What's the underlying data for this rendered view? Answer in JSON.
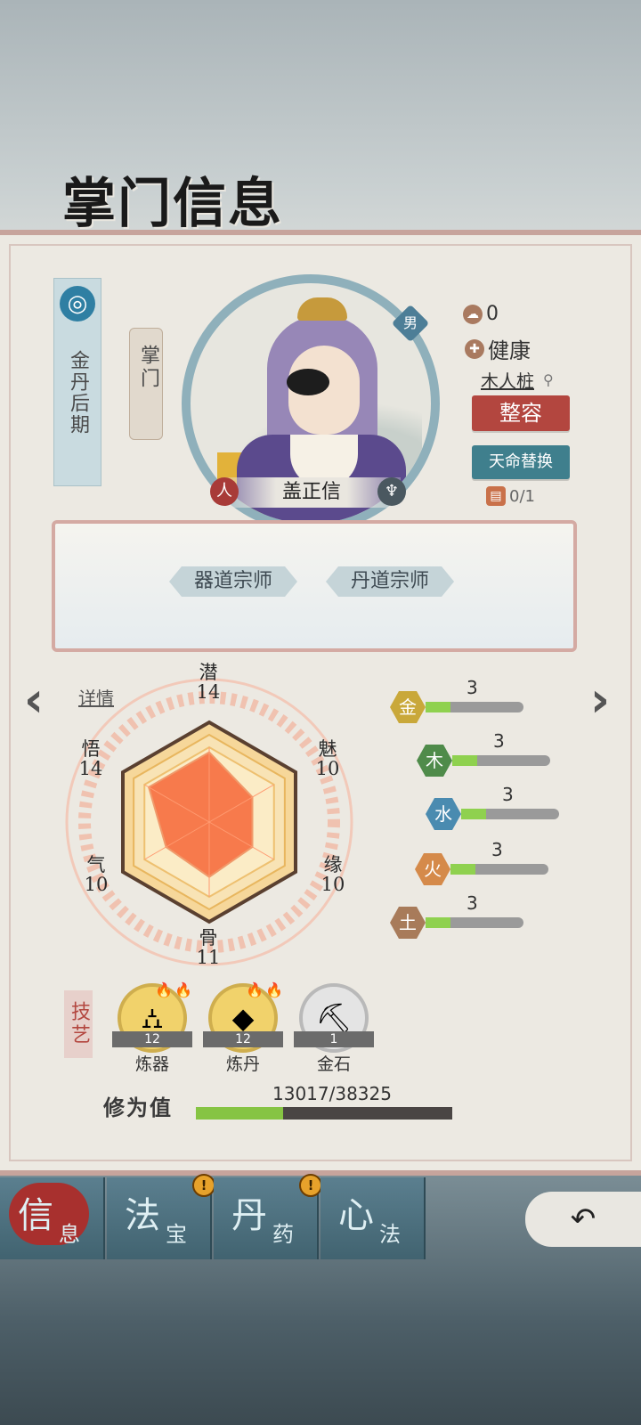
{
  "title": "掌门信息",
  "rank": "金丹后期",
  "role": "掌门",
  "character": {
    "name": "盖正信",
    "gender": "男",
    "race_badge": "人",
    "sect_badge": "♆"
  },
  "status": {
    "reputation": "0",
    "health": "健康",
    "location": "木人桩",
    "makeover_button": "整容",
    "fate_swap_button": "天命替换",
    "fate_count": "0/1"
  },
  "titles": [
    "器道宗师",
    "丹道宗师"
  ],
  "details_link": "详情",
  "stats": {
    "qian": {
      "label": "潜",
      "value": 14
    },
    "mei": {
      "label": "魅",
      "value": 10
    },
    "yuan": {
      "label": "缘",
      "value": 10
    },
    "gu": {
      "label": "骨",
      "value": 11
    },
    "qi": {
      "label": "气",
      "value": 10
    },
    "wu": {
      "label": "悟",
      "value": 14
    }
  },
  "elements": [
    {
      "name": "金",
      "value": "3",
      "color": "#c9a83a"
    },
    {
      "name": "木",
      "value": "3",
      "color": "#4f8b4a"
    },
    {
      "name": "水",
      "value": "3",
      "color": "#4a8bb0"
    },
    {
      "name": "火",
      "value": "3",
      "color": "#d58a4a"
    },
    {
      "name": "土",
      "value": "3",
      "color": "#a87b5a"
    }
  ],
  "skills_label": "技艺",
  "skills": [
    {
      "name": "炼器",
      "level": "12",
      "icon": "furnace-icon"
    },
    {
      "name": "炼丹",
      "level": "12",
      "icon": "pill-icon"
    },
    {
      "name": "金石",
      "level": "1",
      "icon": "pickaxe-icon"
    }
  ],
  "cultivation": {
    "label": "修为值",
    "value": "13017/38325",
    "current": 13017,
    "max": 38325
  },
  "tabs": [
    {
      "main": "信",
      "sub": "息",
      "active": true,
      "alert": false
    },
    {
      "main": "法",
      "sub": "宝",
      "active": false,
      "alert": true
    },
    {
      "main": "丹",
      "sub": "药",
      "active": false,
      "alert": true
    },
    {
      "main": "心",
      "sub": "法",
      "active": false,
      "alert": false
    }
  ],
  "alert_symbol": "!",
  "colors": {
    "accent_red": "#b3463f",
    "teal": "#3f7f8d",
    "panel": "#ece9e2"
  }
}
